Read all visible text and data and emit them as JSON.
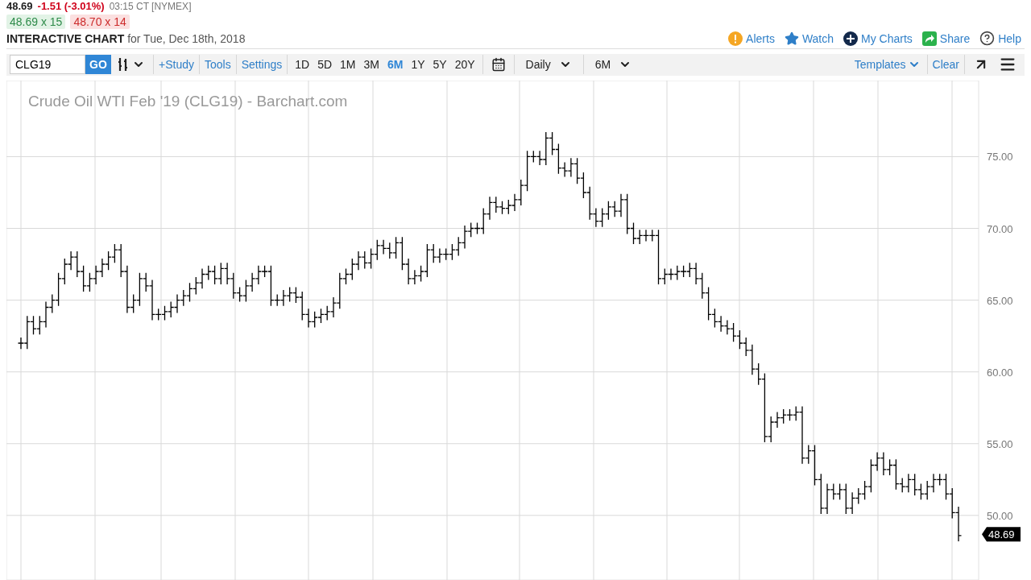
{
  "quote": {
    "last": "48.69",
    "change": "-1.51 (-3.01%)",
    "time": "03:15 CT [NYMEX]",
    "bid": "48.69 x 15",
    "ask": "48.70 x 14"
  },
  "header": {
    "title": "INTERACTIVE CHART",
    "subtitle": "for Tue, Dec 18th, 2018",
    "links": [
      {
        "kind": "alert",
        "label": "Alerts"
      },
      {
        "kind": "watch",
        "label": "Watch"
      },
      {
        "kind": "mycharts",
        "label": "My Charts"
      },
      {
        "kind": "share",
        "label": "Share"
      },
      {
        "kind": "help",
        "label": "Help"
      }
    ]
  },
  "toolbar": {
    "symbol": "CLG19",
    "go": "GO",
    "links": [
      "+Study",
      "Tools",
      "Settings"
    ],
    "ranges": [
      {
        "label": "1D",
        "selected": false
      },
      {
        "label": "5D",
        "selected": false
      },
      {
        "label": "1M",
        "selected": false
      },
      {
        "label": "3M",
        "selected": false
      },
      {
        "label": "6M",
        "selected": true
      },
      {
        "label": "1Y",
        "selected": false
      },
      {
        "label": "5Y",
        "selected": false
      },
      {
        "label": "20Y",
        "selected": false
      }
    ],
    "interval": "Daily",
    "period": "6M",
    "templates": "Templates",
    "clear": "Clear"
  },
  "chart": {
    "title": "Crude Oil WTI Feb '19 (CLG19) - Barchart.com",
    "last_price": "48.69",
    "axis_labels": [
      "75.00",
      "70.00",
      "65.00",
      "60.00",
      "55.00",
      "50.00"
    ]
  }
}
